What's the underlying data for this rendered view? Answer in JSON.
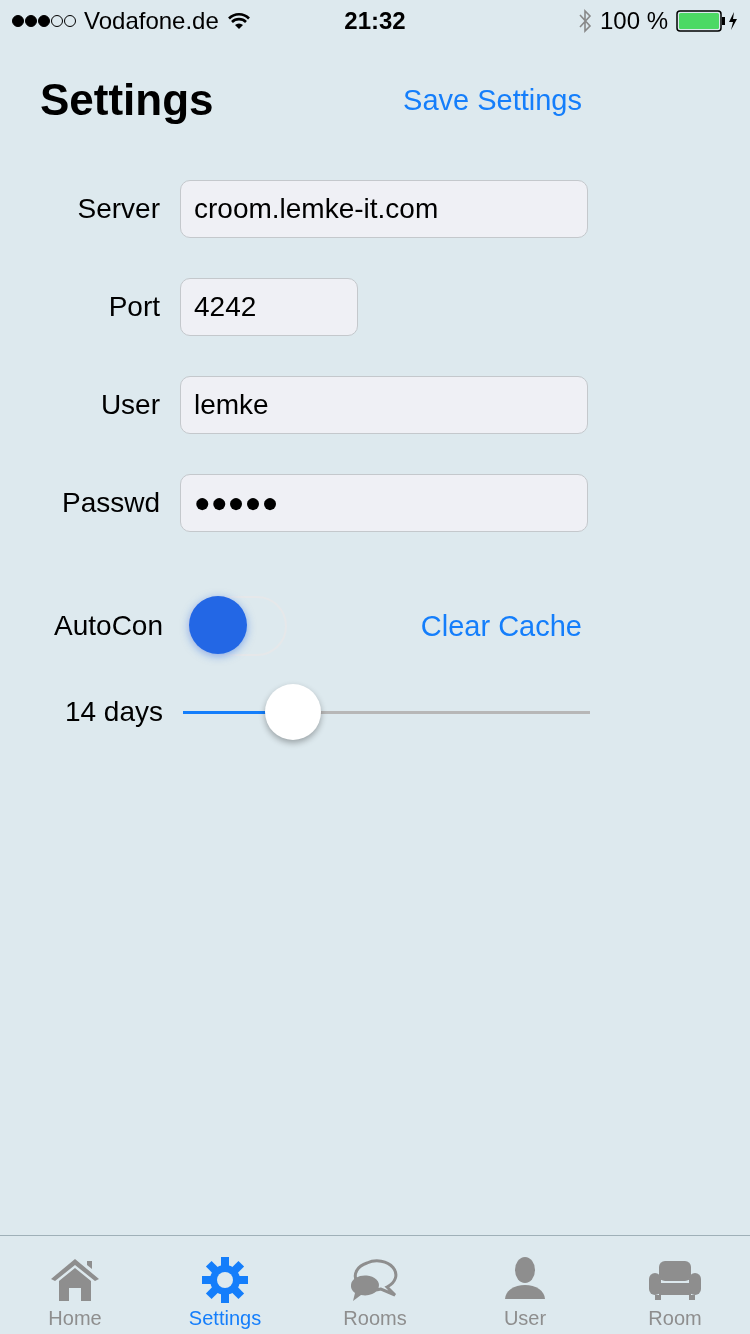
{
  "status_bar": {
    "carrier": "Vodafone.de",
    "time": "21:32",
    "battery": "100 %"
  },
  "header": {
    "title": "Settings",
    "action": "Save Settings"
  },
  "fields": [
    {
      "label": "Server",
      "value": "croom.lemke-it.com",
      "kind": "wide"
    },
    {
      "label": "Port",
      "value": "4242",
      "kind": "narrow"
    },
    {
      "label": "User",
      "value": "lemke",
      "kind": "wide"
    },
    {
      "label": "Passwd",
      "value": "●●●●●",
      "kind": "wide"
    }
  ],
  "autocon": {
    "label": "AutoCon",
    "on": false
  },
  "clear_cache": "Clear Cache",
  "slider": {
    "label": "14 days",
    "level": 0.27
  },
  "tabs": [
    {
      "label": "Home",
      "kind": "home",
      "selected": false
    },
    {
      "label": "Settings",
      "kind": "gear",
      "selected": true
    },
    {
      "label": "Rooms",
      "kind": "chat",
      "selected": false
    },
    {
      "label": "User",
      "kind": "person",
      "selected": false
    },
    {
      "label": "Room",
      "kind": "sofa",
      "selected": false
    }
  ]
}
